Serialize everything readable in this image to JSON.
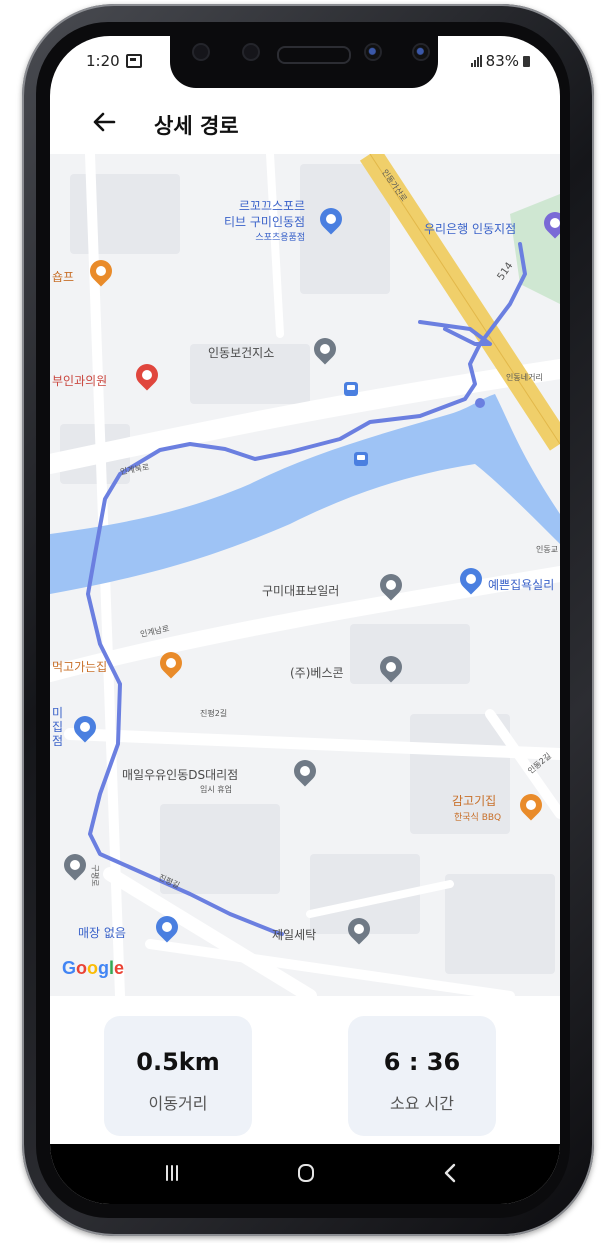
{
  "status_bar": {
    "time": "1:20",
    "battery": "83%"
  },
  "header": {
    "title": "상세 경로"
  },
  "map": {
    "labels": {
      "sports_store": [
        "르꼬끄스포르",
        "티브 구미인동점",
        "스포츠용품점"
      ],
      "bank": "우리은행 인동지점",
      "shop_left": "숍프",
      "health_center": "인동보건지소",
      "clinic": "부인과의원",
      "boiler": "구미대표보일러",
      "bath_store": "예쁜집욕실리",
      "restaurant": "먹고가는집",
      "besscon": "(주)베스콘",
      "milk_agency": "매일우유인동DS대리점",
      "milk_agency_sub": "임시 휴업",
      "bbq": "감고기집",
      "bbq_sub": "한국식 BBQ",
      "laundry": "제일세탁",
      "no_store": "매장 없음",
      "left_cut": [
        "미",
        "집",
        "점"
      ],
      "road_514": "514",
      "road_indong_gaisan": "인동가산로",
      "road_indong_crossing": "인동네거리",
      "road_ingye": "인계북로",
      "road_ingye2": "인계남로",
      "road_jinpyeong": "진평2길",
      "road_jinpyeong2": "진평길",
      "road_indong2": "인동2길",
      "road_indong_right": "인동교",
      "vertical_left": "구평로"
    },
    "attribution": "Google"
  },
  "stats": {
    "distance_value": "0.5km",
    "distance_label": "이동거리",
    "time_value": "6 : 36",
    "time_label": "소요 시간"
  },
  "colors": {
    "route": "#6b7fe0",
    "water": "#9ec3f5",
    "highway": "#f0cf6a"
  }
}
